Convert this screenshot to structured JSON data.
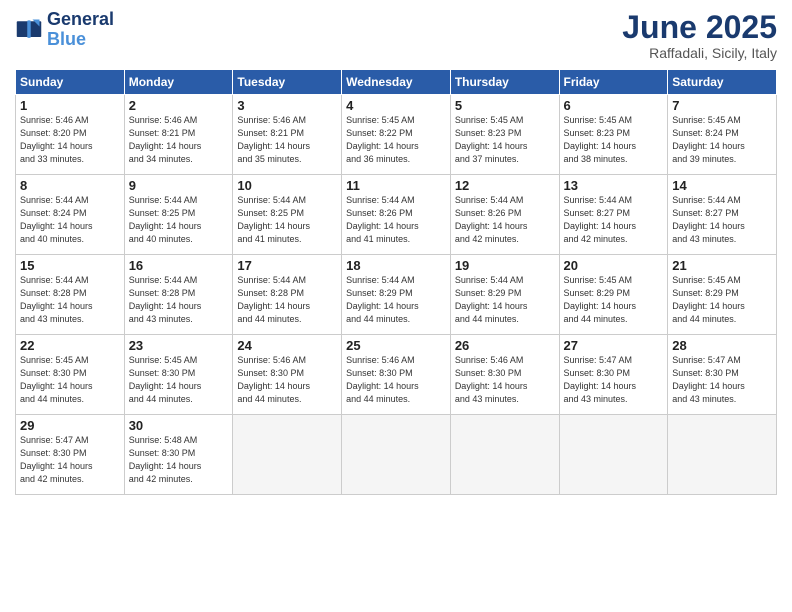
{
  "logo": {
    "line1": "General",
    "line2": "Blue"
  },
  "title": "June 2025",
  "subtitle": "Raffadali, Sicily, Italy",
  "headers": [
    "Sunday",
    "Monday",
    "Tuesday",
    "Wednesday",
    "Thursday",
    "Friday",
    "Saturday"
  ],
  "weeks": [
    [
      {
        "day": "1",
        "info": "Sunrise: 5:46 AM\nSunset: 8:20 PM\nDaylight: 14 hours\nand 33 minutes."
      },
      {
        "day": "2",
        "info": "Sunrise: 5:46 AM\nSunset: 8:21 PM\nDaylight: 14 hours\nand 34 minutes."
      },
      {
        "day": "3",
        "info": "Sunrise: 5:46 AM\nSunset: 8:21 PM\nDaylight: 14 hours\nand 35 minutes."
      },
      {
        "day": "4",
        "info": "Sunrise: 5:45 AM\nSunset: 8:22 PM\nDaylight: 14 hours\nand 36 minutes."
      },
      {
        "day": "5",
        "info": "Sunrise: 5:45 AM\nSunset: 8:23 PM\nDaylight: 14 hours\nand 37 minutes."
      },
      {
        "day": "6",
        "info": "Sunrise: 5:45 AM\nSunset: 8:23 PM\nDaylight: 14 hours\nand 38 minutes."
      },
      {
        "day": "7",
        "info": "Sunrise: 5:45 AM\nSunset: 8:24 PM\nDaylight: 14 hours\nand 39 minutes."
      }
    ],
    [
      {
        "day": "8",
        "info": "Sunrise: 5:44 AM\nSunset: 8:24 PM\nDaylight: 14 hours\nand 40 minutes."
      },
      {
        "day": "9",
        "info": "Sunrise: 5:44 AM\nSunset: 8:25 PM\nDaylight: 14 hours\nand 40 minutes."
      },
      {
        "day": "10",
        "info": "Sunrise: 5:44 AM\nSunset: 8:25 PM\nDaylight: 14 hours\nand 41 minutes."
      },
      {
        "day": "11",
        "info": "Sunrise: 5:44 AM\nSunset: 8:26 PM\nDaylight: 14 hours\nand 41 minutes."
      },
      {
        "day": "12",
        "info": "Sunrise: 5:44 AM\nSunset: 8:26 PM\nDaylight: 14 hours\nand 42 minutes."
      },
      {
        "day": "13",
        "info": "Sunrise: 5:44 AM\nSunset: 8:27 PM\nDaylight: 14 hours\nand 42 minutes."
      },
      {
        "day": "14",
        "info": "Sunrise: 5:44 AM\nSunset: 8:27 PM\nDaylight: 14 hours\nand 43 minutes."
      }
    ],
    [
      {
        "day": "15",
        "info": "Sunrise: 5:44 AM\nSunset: 8:28 PM\nDaylight: 14 hours\nand 43 minutes."
      },
      {
        "day": "16",
        "info": "Sunrise: 5:44 AM\nSunset: 8:28 PM\nDaylight: 14 hours\nand 43 minutes."
      },
      {
        "day": "17",
        "info": "Sunrise: 5:44 AM\nSunset: 8:28 PM\nDaylight: 14 hours\nand 44 minutes."
      },
      {
        "day": "18",
        "info": "Sunrise: 5:44 AM\nSunset: 8:29 PM\nDaylight: 14 hours\nand 44 minutes."
      },
      {
        "day": "19",
        "info": "Sunrise: 5:44 AM\nSunset: 8:29 PM\nDaylight: 14 hours\nand 44 minutes."
      },
      {
        "day": "20",
        "info": "Sunrise: 5:45 AM\nSunset: 8:29 PM\nDaylight: 14 hours\nand 44 minutes."
      },
      {
        "day": "21",
        "info": "Sunrise: 5:45 AM\nSunset: 8:29 PM\nDaylight: 14 hours\nand 44 minutes."
      }
    ],
    [
      {
        "day": "22",
        "info": "Sunrise: 5:45 AM\nSunset: 8:30 PM\nDaylight: 14 hours\nand 44 minutes."
      },
      {
        "day": "23",
        "info": "Sunrise: 5:45 AM\nSunset: 8:30 PM\nDaylight: 14 hours\nand 44 minutes."
      },
      {
        "day": "24",
        "info": "Sunrise: 5:46 AM\nSunset: 8:30 PM\nDaylight: 14 hours\nand 44 minutes."
      },
      {
        "day": "25",
        "info": "Sunrise: 5:46 AM\nSunset: 8:30 PM\nDaylight: 14 hours\nand 44 minutes."
      },
      {
        "day": "26",
        "info": "Sunrise: 5:46 AM\nSunset: 8:30 PM\nDaylight: 14 hours\nand 43 minutes."
      },
      {
        "day": "27",
        "info": "Sunrise: 5:47 AM\nSunset: 8:30 PM\nDaylight: 14 hours\nand 43 minutes."
      },
      {
        "day": "28",
        "info": "Sunrise: 5:47 AM\nSunset: 8:30 PM\nDaylight: 14 hours\nand 43 minutes."
      }
    ],
    [
      {
        "day": "29",
        "info": "Sunrise: 5:47 AM\nSunset: 8:30 PM\nDaylight: 14 hours\nand 42 minutes."
      },
      {
        "day": "30",
        "info": "Sunrise: 5:48 AM\nSunset: 8:30 PM\nDaylight: 14 hours\nand 42 minutes."
      },
      {
        "day": "",
        "info": ""
      },
      {
        "day": "",
        "info": ""
      },
      {
        "day": "",
        "info": ""
      },
      {
        "day": "",
        "info": ""
      },
      {
        "day": "",
        "info": ""
      }
    ]
  ]
}
